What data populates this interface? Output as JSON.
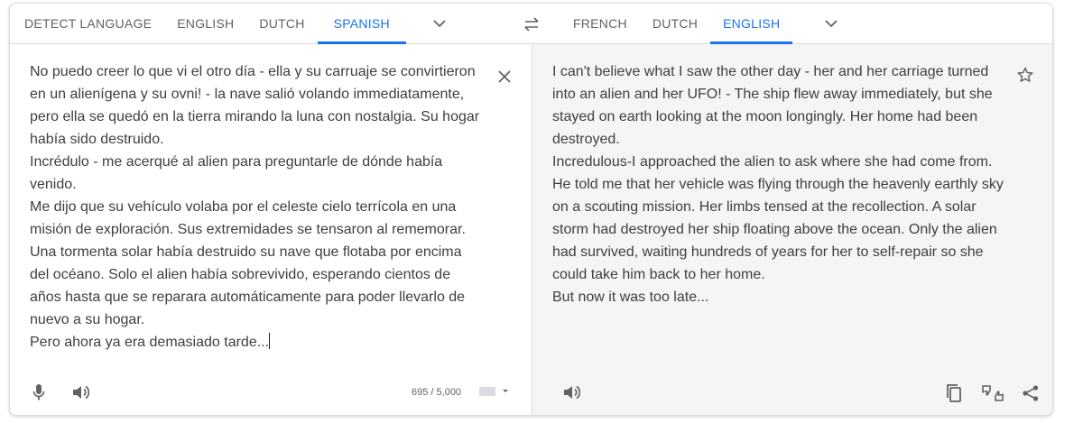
{
  "source": {
    "languages": [
      {
        "label": "DETECT LANGUAGE",
        "active": false
      },
      {
        "label": "ENGLISH",
        "active": false
      },
      {
        "label": "DUTCH",
        "active": false
      },
      {
        "label": "SPANISH",
        "active": true
      }
    ],
    "text": "No puedo creer lo que vi el otro día - ella y su carruaje se convirtieron en un alienígena y su ovni! - la nave salió volando immediatamente, pero ella se quedó en la tierra mirando la luna con nostalgia. Su hogar había sido destruido.\nIncrédulo - me acerqué al alien para preguntarle de dónde había venido.\nMe dijo que su vehículo volaba por el celeste cielo terrícola en una misión de exploración. Sus extremidades se tensaron al rememorar. Una tormenta solar había destruido su nave que flotaba por encima del océano. Solo el alien había sobrevivido, esperando cientos de años hasta que se reparara automáticamente para poder llevarlo de nuevo a su hogar.\nPero ahora ya era demasiado tarde...",
    "char_count": "695 / 5,000"
  },
  "target": {
    "languages": [
      {
        "label": "FRENCH",
        "active": false
      },
      {
        "label": "DUTCH",
        "active": false
      },
      {
        "label": "ENGLISH",
        "active": true
      }
    ],
    "text": "I can't believe what I saw the other day - her and her carriage turned into an alien and her UFO! - The ship flew away immediately, but she stayed on earth looking at the moon longingly. Her home had been destroyed.\nIncredulous-I approached the alien to ask where she had come from. He told me that her vehicle was flying through the heavenly earthly sky on a scouting mission. Her limbs tensed at the recollection. A solar storm had destroyed her ship floating above the ocean. Only the alien had survived, waiting hundreds of years for her to self-repair so she could take him back to her home.\nBut now it was too late..."
  },
  "colors": {
    "accent": "#1a73e8",
    "icon": "#5f6368",
    "target_bg": "#f5f5f5"
  },
  "icons": [
    "chevron-down-icon",
    "swap-icon",
    "close-icon",
    "star-icon",
    "microphone-icon",
    "speaker-icon",
    "keyboard-icon",
    "copy-icon",
    "feedback-icon",
    "share-icon"
  ]
}
